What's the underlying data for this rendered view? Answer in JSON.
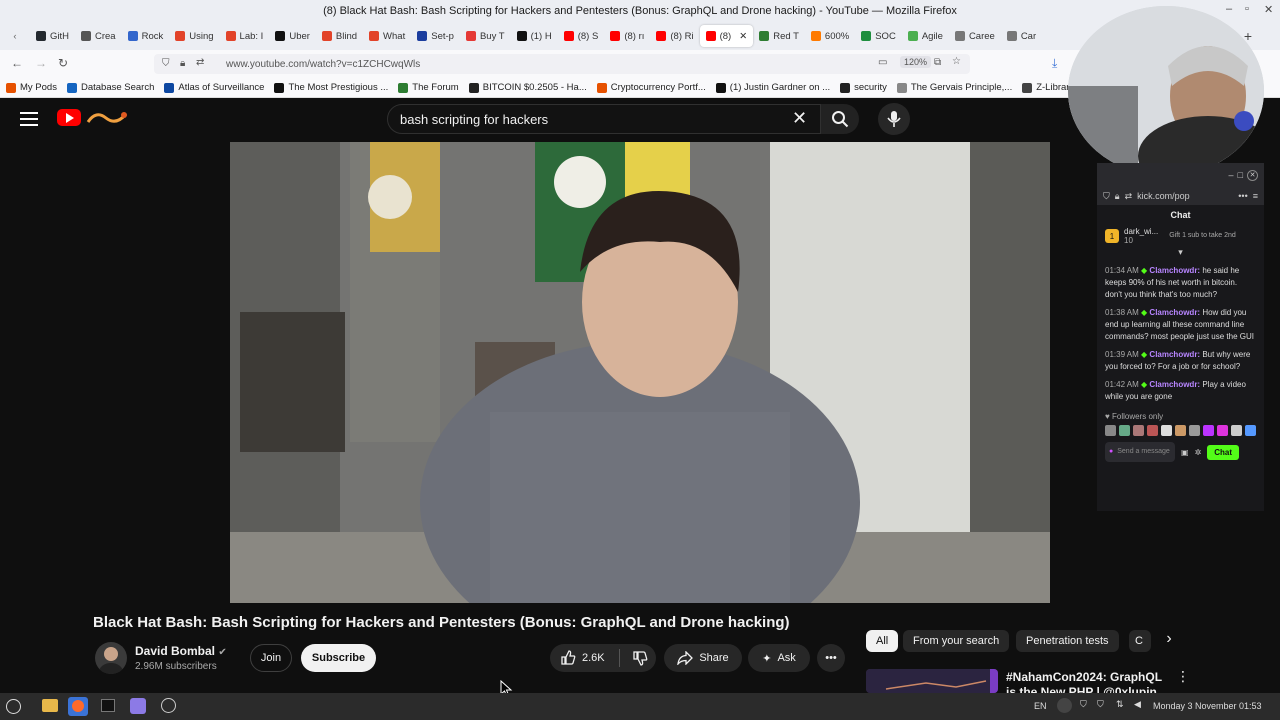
{
  "window": {
    "title": "(8) Black Hat Bash: Bash Scripting for Hackers and Pentesters (Bonus: GraphQL and Drone hacking) - YouTube — Mozilla Firefox"
  },
  "tabs": [
    {
      "label": "GitH",
      "color": "#24292f"
    },
    {
      "label": "Crea",
      "color": "#555555"
    },
    {
      "label": "Rock",
      "color": "#3366cc"
    },
    {
      "label": "Using",
      "color": "#e24329"
    },
    {
      "label": "Lab: I",
      "color": "#e24329"
    },
    {
      "label": "Uber",
      "color": "#111111"
    },
    {
      "label": "Blind",
      "color": "#e24329"
    },
    {
      "label": "What",
      "color": "#e24329"
    },
    {
      "label": "Set-p",
      "color": "#1b3d9e"
    },
    {
      "label": "Buy T",
      "color": "#e53935"
    },
    {
      "label": "(1) H",
      "color": "#111111"
    },
    {
      "label": "(8) S",
      "color": "#ff0000"
    },
    {
      "label": "(8) rı",
      "color": "#ff0000"
    },
    {
      "label": "(8) Ri",
      "color": "#ff0000"
    },
    {
      "label": "(8)",
      "color": "#ff0000",
      "active": true
    },
    {
      "label": "Red T",
      "color": "#2e7d32"
    },
    {
      "label": "600%",
      "color": "#ff7a00"
    },
    {
      "label": "SOC",
      "color": "#1e8e3e"
    },
    {
      "label": "Agile",
      "color": "#4caf50"
    },
    {
      "label": "Caree",
      "color": "#777777"
    },
    {
      "label": "Car",
      "color": "#777777"
    }
  ],
  "navbar": {
    "url": "www.youtube.com/watch?v=c1ZCHCwqWls",
    "zoom": "120%"
  },
  "bookmarks": [
    {
      "label": "My Pods",
      "color": "#e65100"
    },
    {
      "label": "Database Search",
      "color": "#1565c0"
    },
    {
      "label": "Atlas of Surveillance",
      "color": "#0d47a1"
    },
    {
      "label": "The Most Prestigious ...",
      "color": "#111111"
    },
    {
      "label": "The Forum",
      "color": "#2e7d32"
    },
    {
      "label": "BITCOIN $0.2505 - Ha...",
      "color": "#222222"
    },
    {
      "label": "Cryptocurrency Portf...",
      "color": "#e65100"
    },
    {
      "label": "(1) Justin Gardner on ...",
      "color": "#111111"
    },
    {
      "label": "security",
      "color": "#222222"
    },
    {
      "label": "The Gervais Principle,...",
      "color": "#888888"
    },
    {
      "label": "Z-Library – the world'",
      "color": "#444444"
    }
  ],
  "youtube": {
    "search_value": "bash scripting for hackers",
    "video_title": "Black Hat Bash: Bash Scripting for Hackers and Pentesters (Bonus: GraphQL and Drone hacking)",
    "channel": {
      "name": "David Bombal",
      "verified": true,
      "subscribers": "2.96M subscribers"
    },
    "buttons": {
      "join": "Join",
      "subscribe": "Subscribe",
      "likes": "2.6K",
      "share": "Share",
      "ask": "Ask"
    },
    "chips": [
      "All",
      "From your search",
      "Penetration tests",
      "C"
    ],
    "recommended_title": "#NahamCon2024: GraphQL is the New PHP | @0xlupin"
  },
  "kick_popup": {
    "url": "kick.com/pop",
    "header": "Chat",
    "pinned": {
      "user": "dark_wi...",
      "count": "10",
      "badge": "1",
      "text": "Gift 1 sub to take 2nd"
    },
    "messages": [
      {
        "time": "01:34 AM",
        "user": "Clamchowdr:",
        "text": "he said he keeps 90% of his net worth in bitcoin. don't you think that's too much?"
      },
      {
        "time": "01:38 AM",
        "user": "Clamchowdr:",
        "text": "How did you end up learning all these command line commands? most people just use the GUI"
      },
      {
        "time": "01:39 AM",
        "user": "Clamchowdr:",
        "text": "But why were you forced to? For a job or for school?"
      },
      {
        "time": "01:42 AM",
        "user": "Clamchowdr:",
        "text": "Play a video while you are gone"
      }
    ],
    "followers_only": "Followers only",
    "input_placeholder": "Send a message",
    "send_button": "Chat"
  },
  "taskbar": {
    "keyboard": "EN",
    "datetime": "Monday  3 November 01:53"
  }
}
